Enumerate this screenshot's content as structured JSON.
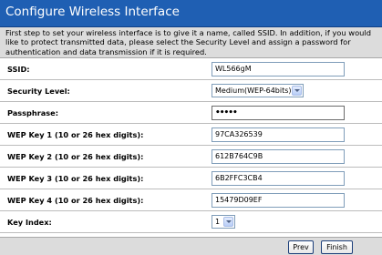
{
  "header": {
    "title": "Configure Wireless Interface"
  },
  "intro": {
    "text": "First step to set your wireless interface is to give it a name, called SSID. In addition, if you would like to protect transmitted data, please select the Security Level and assign a password for authentication and data transmission if it is required."
  },
  "form": {
    "ssid": {
      "label": "SSID:",
      "value": "WL566gM"
    },
    "security": {
      "label": "Security Level:",
      "value": "Medium(WEP-64bits)"
    },
    "passphrase": {
      "label": "Passphrase:",
      "value": "•••••"
    },
    "wep1": {
      "label": "WEP Key 1 (10 or 26 hex digits):",
      "value": "97CA326539"
    },
    "wep2": {
      "label": "WEP Key 2 (10 or 26 hex digits):",
      "value": "612B764C9B"
    },
    "wep3": {
      "label": "WEP Key 3 (10 or 26 hex digits):",
      "value": "6B2FFC3CB4"
    },
    "wep4": {
      "label": "WEP Key 4 (10 or 26 hex digits):",
      "value": "15479D09EF"
    },
    "key_index": {
      "label": "Key Index:",
      "value": "1"
    }
  },
  "buttons": {
    "prev": "Prev",
    "finish": "Finish"
  },
  "colors": {
    "header_bg": "#1f5fb3",
    "panel_bg": "#dcdcdc"
  }
}
